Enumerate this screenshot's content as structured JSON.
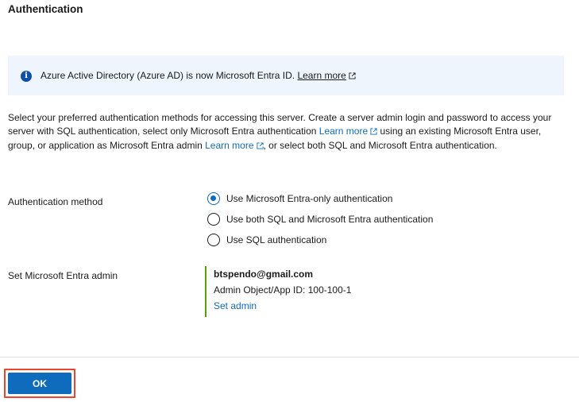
{
  "section_title": "Authentication",
  "banner": {
    "message": "Azure Active Directory (Azure AD) is now Microsoft Entra ID.",
    "link": "Learn more"
  },
  "description": {
    "part1": "Select your preferred authentication methods for accessing this server. Create a server admin login and password to access your server with SQL authentication, select only Microsoft Entra authentication ",
    "link1": "Learn more",
    "part2": " using an existing Microsoft Entra user, group, or application as Microsoft Entra admin ",
    "link2": "Learn more",
    "part3": ", or select both SQL and Microsoft Entra authentication."
  },
  "auth_method": {
    "label": "Authentication method",
    "options": [
      {
        "label": "Use Microsoft Entra-only authentication",
        "checked": true
      },
      {
        "label": "Use both SQL and Microsoft Entra authentication",
        "checked": false
      },
      {
        "label": "Use SQL authentication",
        "checked": false
      }
    ]
  },
  "entra_admin": {
    "label": "Set Microsoft Entra admin",
    "email": "btspendo@gmail.com",
    "object_id": "Admin Object/App ID: 100-100-1",
    "set_link": "Set admin"
  },
  "footer": {
    "ok_label": "OK"
  },
  "colors": {
    "accent": "#0f6cbd",
    "admin_bar": "#57a300",
    "highlight_outline": "#e8472e"
  }
}
